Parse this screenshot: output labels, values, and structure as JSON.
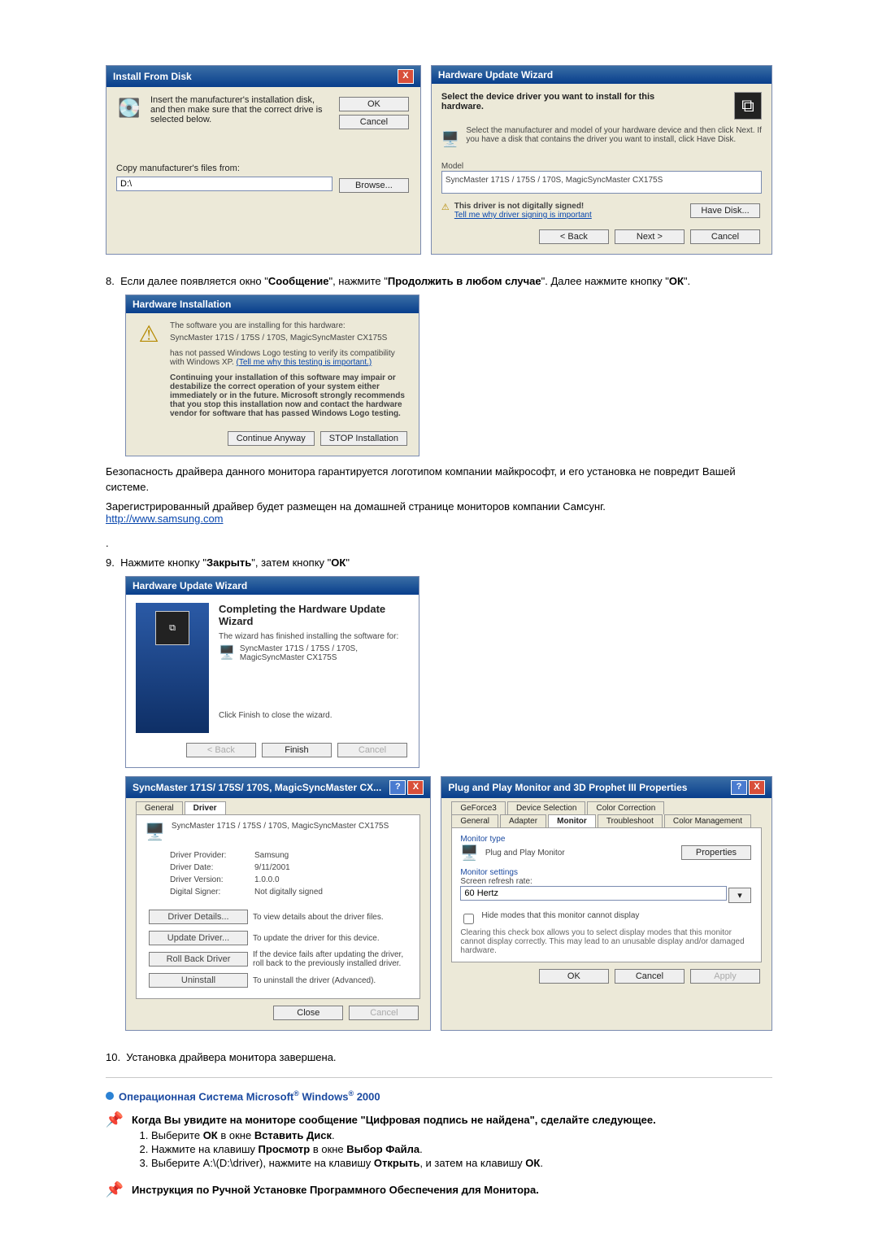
{
  "dlg_install_from_disk": {
    "title": "Install From Disk",
    "instruction": "Insert the manufacturer's installation disk, and then make sure that the correct drive is selected below.",
    "ok": "OK",
    "cancel": "Cancel",
    "copy_from_label": "Copy manufacturer's files from:",
    "path_value": "D:\\",
    "browse": "Browse..."
  },
  "dlg_hw_wizard_select": {
    "title": "Hardware Update Wizard",
    "heading": "Select the device driver you want to install for this hardware.",
    "text": "Select the manufacturer and model of your hardware device and then click Next. If you have a disk that contains the driver you want to install, click Have Disk.",
    "model_label": "Model",
    "model_item": "SyncMaster 171S / 175S / 170S, MagicSyncMaster CX175S",
    "warn_text": "This driver is not digitally signed!",
    "warn_link": "Tell me why driver signing is important",
    "have_disk": "Have Disk...",
    "back": "< Back",
    "next": "Next >",
    "cancel": "Cancel"
  },
  "step8": {
    "prefix": "Если далее появляется окно \"",
    "msg_word": "Сообщение",
    "mid1": "\", нажмите \"",
    "continue_word": "Продолжить в любом случае",
    "mid2": "\". Далее нажмите кнопку \"",
    "ok_word": "ОК",
    "suffix": "\"."
  },
  "dlg_hw_installation": {
    "title": "Hardware Installation",
    "line1": "The software you are installing for this hardware:",
    "device": "SyncMaster 171S / 175S / 170S, MagicSyncMaster CX175S",
    "line2a": "has not passed Windows Logo testing to verify its compatibility with Windows XP.",
    "line2_link": "(Tell me why this testing is important.)",
    "bold_block": "Continuing your installation of this software may impair or destabilize the correct operation of your system either immediately or in the future. Microsoft strongly recommends that you stop this installation now and contact the hardware vendor for software that has passed Windows Logo testing.",
    "continue": "Continue Anyway",
    "stop": "STOP Installation"
  },
  "step8_after": {
    "p1": "Безопасность драйвера данного монитора гарантируется логотипом компании майкрософт, и его установка не повредит Вашей системе.",
    "p2": "Зарегистрированный драйвер будет размещен на домашней странице мониторов компании Самсунг.",
    "link": "http://www.samsung.com"
  },
  "step9": {
    "prefix": "Нажмите кнопку \"",
    "close_word": "Закрыть",
    "mid": "\", затем кнопку \"",
    "ok_word": "ОК",
    "suffix": "\""
  },
  "dlg_hw_wizard_complete": {
    "title": "Hardware Update Wizard",
    "heading": "Completing the Hardware Update Wizard",
    "line1": "The wizard has finished installing the software for:",
    "device": "SyncMaster 171S / 175S / 170S, MagicSyncMaster CX175S",
    "line2": "Click Finish to close the wizard.",
    "back": "< Back",
    "finish": "Finish",
    "cancel": "Cancel"
  },
  "dlg_driver_props": {
    "title": "SyncMaster 171S/ 175S/ 170S, MagicSyncMaster CX...",
    "tab_general": "General",
    "tab_driver": "Driver",
    "device": "SyncMaster 171S / 175S / 170S, MagicSyncMaster CX175S",
    "provider_label": "Driver Provider:",
    "provider": "Samsung",
    "date_label": "Driver Date:",
    "date": "9/11/2001",
    "version_label": "Driver Version:",
    "version": "1.0.0.0",
    "signer_label": "Digital Signer:",
    "signer": "Not digitally signed",
    "btn_details": "Driver Details...",
    "btn_details_txt": "To view details about the driver files.",
    "btn_update": "Update Driver...",
    "btn_update_txt": "To update the driver for this device.",
    "btn_rollback": "Roll Back Driver",
    "btn_rollback_txt": "If the device fails after updating the driver, roll back to the previously installed driver.",
    "btn_uninstall": "Uninstall",
    "btn_uninstall_txt": "To uninstall the driver (Advanced).",
    "close": "Close",
    "cancel": "Cancel"
  },
  "dlg_pnp_props": {
    "title": "Plug and Play Monitor and 3D Prophet III Properties",
    "tab1": "GeForce3",
    "tab2": "Device Selection",
    "tab3": "Color Correction",
    "tab4": "General",
    "tab5": "Adapter",
    "tab6": "Monitor",
    "tab7": "Troubleshoot",
    "tab8": "Color Management",
    "monitor_type_label": "Monitor type",
    "monitor_type": "Plug and Play Monitor",
    "properties": "Properties",
    "monitor_settings_label": "Monitor settings",
    "refresh_label": "Screen refresh rate:",
    "refresh_value": "60 Hertz",
    "hide_checkbox": "Hide modes that this monitor cannot display",
    "hide_hint": "Clearing this check box allows you to select display modes that this monitor cannot display correctly. This may lead to an unusable display and/or damaged hardware.",
    "ok": "OK",
    "cancel": "Cancel",
    "apply": "Apply"
  },
  "step10": "Установка драйвера монитора завершена.",
  "section_win2000": {
    "heading_prefix": "Операционная Система Microsoft",
    "heading_mid": " Windows",
    "heading_suffix": " 2000",
    "reg": "®",
    "sub1": "Когда Вы увидите на мониторе сообщение \"Цифровая подпись не найдена\", сделайте следующее.",
    "li1_a": "Выберите ",
    "li1_b": "ОК",
    "li1_c": " в окне ",
    "li1_d": "Вставить Диск",
    "li1_e": ".",
    "li2_a": "Нажмите на клавишу ",
    "li2_b": "Просмотр",
    "li2_c": " в окне ",
    "li2_d": "Выбор Файла",
    "li2_e": ".",
    "li3_a": "Выберите A:\\(D:\\driver), нажмите на клавишу ",
    "li3_b": "Открыть",
    "li3_c": ", и затем на клавишу ",
    "li3_d": "ОК",
    "li3_e": ".",
    "sub2": "Инструкция по Ручной Установке Программного Обеспечения для Монитора."
  }
}
